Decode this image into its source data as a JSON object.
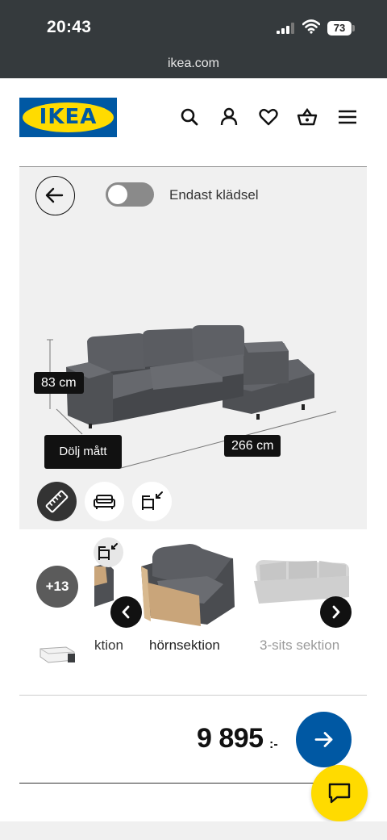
{
  "status_bar": {
    "time": "20:43",
    "battery": "73",
    "url": "ikea.com"
  },
  "header": {
    "logo_text": "IKEA",
    "icons": [
      "search-icon",
      "user-icon",
      "heart-icon",
      "basket-icon",
      "menu-icon"
    ]
  },
  "viewer": {
    "toggle_label": "Endast klädsel",
    "toggle_on": false,
    "height_label": "83 cm",
    "width_label": "266 cm",
    "tooltip": "Dölj mått",
    "view_buttons": [
      "ruler-icon",
      "sofa-icon",
      "sections-icon"
    ]
  },
  "carousel": {
    "more_count": "+13",
    "items": [
      {
        "label": "ktion"
      },
      {
        "label": "hörnsektion"
      },
      {
        "label": "3-sits sektion"
      }
    ]
  },
  "price": {
    "amount": "9 895",
    "currency": ":-"
  },
  "colors": {
    "brand_blue": "#0058a3",
    "brand_yellow": "#ffdb00",
    "dark": "#111111",
    "viewer_bg": "#f0f0f0"
  }
}
